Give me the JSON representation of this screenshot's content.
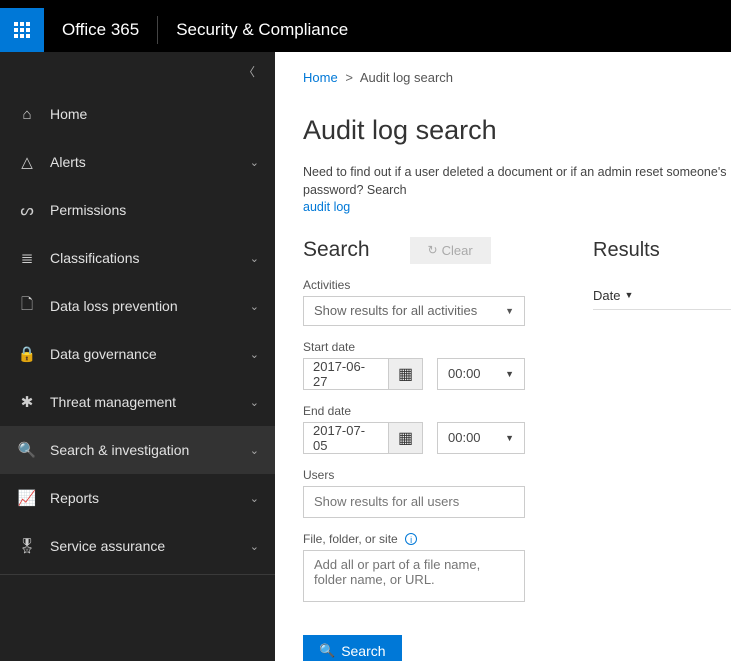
{
  "header": {
    "brand": "Office 365",
    "appTitle": "Security & Compliance"
  },
  "nav": {
    "items": [
      {
        "icon": "⌂",
        "label": "Home",
        "expandable": false
      },
      {
        "icon": "△",
        "label": "Alerts",
        "expandable": true
      },
      {
        "icon": "ᔕ",
        "label": "Permissions",
        "expandable": false
      },
      {
        "icon": "≣",
        "label": "Classifications",
        "expandable": true
      },
      {
        "icon": "🗋",
        "label": "Data loss prevention",
        "expandable": true
      },
      {
        "icon": "🔒",
        "label": "Data governance",
        "expandable": true
      },
      {
        "icon": "✱",
        "label": "Threat management",
        "expandable": true
      },
      {
        "icon": "🔍",
        "label": "Search & investigation",
        "expandable": true,
        "selected": true
      },
      {
        "icon": "📈",
        "label": "Reports",
        "expandable": true
      },
      {
        "icon": "🎖",
        "label": "Service assurance",
        "expandable": true
      }
    ]
  },
  "breadcrumb": {
    "home": "Home",
    "sep": ">",
    "current": "Audit log search"
  },
  "page": {
    "title": "Audit log search",
    "help_prefix": "Need to find out if a user deleted a document or if an admin reset someone's password? Search",
    "help_link": "audit log"
  },
  "search": {
    "heading": "Search",
    "clear_label": "Clear",
    "activities_label": "Activities",
    "activities_value": "Show results for all activities",
    "start_label": "Start date",
    "start_date": "2017-06-27",
    "start_time": "00:00",
    "end_label": "End date",
    "end_date": "2017-07-05",
    "end_time": "00:00",
    "users_label": "Users",
    "users_placeholder": "Show results for all users",
    "file_label": "File, folder, or site",
    "file_placeholder": "Add all or part of a file name, folder name, or URL.",
    "button": "Search"
  },
  "results": {
    "heading": "Results",
    "col_date": "Date"
  }
}
